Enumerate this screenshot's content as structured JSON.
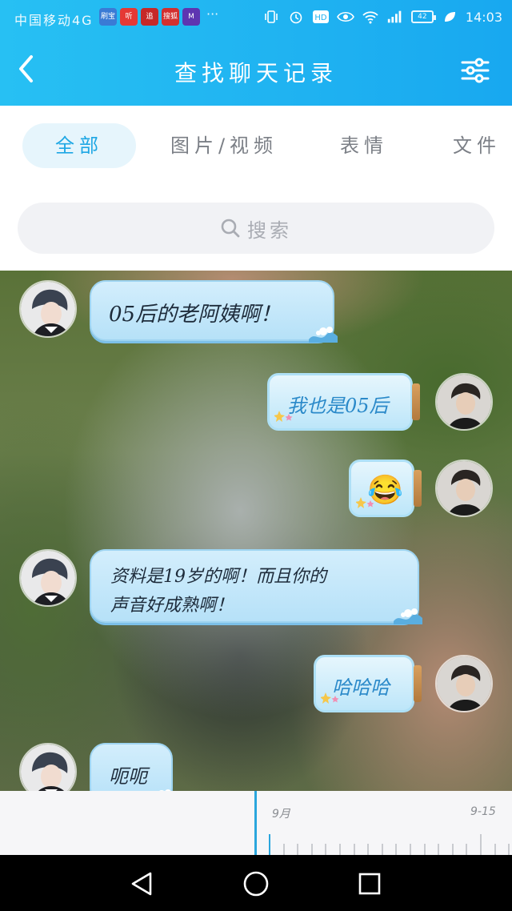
{
  "status_bar": {
    "carrier": "中国移动4G",
    "app_icons": [
      {
        "label": "刷宝",
        "color": "#3a7bd5"
      },
      {
        "label": "听",
        "color": "#e53935"
      },
      {
        "label": "追",
        "color": "#c62828"
      },
      {
        "label": "搜狐",
        "color": "#d32f2f"
      },
      {
        "label": "M",
        "color": "#5e35b1"
      }
    ],
    "more": "···",
    "battery": "42",
    "time": "14:03"
  },
  "header": {
    "title": "查找聊天记录",
    "back_icon": "chevron-left-icon",
    "filter_icon": "sliders-icon"
  },
  "tabs": [
    {
      "label": "全部",
      "active": true
    },
    {
      "label": "图片/视频",
      "active": false
    },
    {
      "label": "表情",
      "active": false
    },
    {
      "label": "文件",
      "active": false
    }
  ],
  "search": {
    "placeholder": "搜索"
  },
  "messages": [
    {
      "side": "left",
      "text": "05后的老阿姨啊！"
    },
    {
      "side": "right",
      "text": "我也是05后"
    },
    {
      "side": "right",
      "text": "😂"
    },
    {
      "side": "left",
      "line1": "资料是19岁的啊！而且你的",
      "line2": "声音好成熟啊！"
    },
    {
      "side": "right",
      "text": "哈哈哈"
    },
    {
      "side": "left",
      "text": "呃呃"
    }
  ],
  "timeline": {
    "month_label": "9月",
    "date_label": "9-15"
  },
  "colors": {
    "accent": "#1ea7e4",
    "header": "#1fb2f1"
  }
}
